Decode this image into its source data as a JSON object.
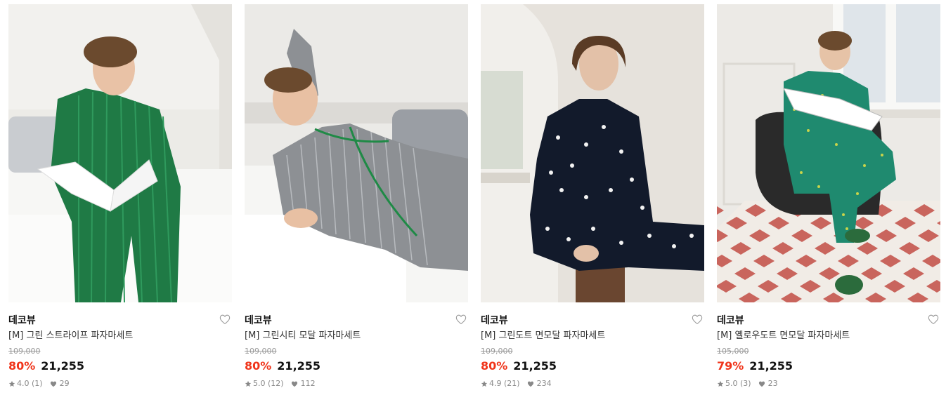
{
  "products": [
    {
      "brand": "데코뷰",
      "title": "[M] 그린 스트라이프 파자마세트",
      "original_price": "109,000",
      "discount": "80%",
      "price": "21,255",
      "rating": "4.0 (1)",
      "likes": "29",
      "photo_alt": "green striped pajama set"
    },
    {
      "brand": "데코뷰",
      "title": "[M] 그린시티 모달 파자마세트",
      "original_price": "109,000",
      "discount": "80%",
      "price": "21,255",
      "rating": "5.0 (12)",
      "likes": "112",
      "photo_alt": "grey striped modal pajama set"
    },
    {
      "brand": "데코뷰",
      "title": "[M] 그린도트 면모달 파자마세트",
      "original_price": "109,000",
      "discount": "80%",
      "price": "21,255",
      "rating": "4.9 (21)",
      "likes": "234",
      "photo_alt": "navy polka dot pajama set"
    },
    {
      "brand": "데코뷰",
      "title": "[M] 옐로우도트 면모달 파자마세트",
      "original_price": "105,000",
      "discount": "79%",
      "price": "21,255",
      "rating": "5.0 (3)",
      "likes": "23",
      "photo_alt": "green dot pajama set"
    }
  ],
  "colors": {
    "discount": "#f0341a",
    "icons": "#888888"
  },
  "icons": {
    "wishlist": "heart-outline-icon",
    "rating": "star-icon",
    "likes": "heart-filled-icon"
  }
}
